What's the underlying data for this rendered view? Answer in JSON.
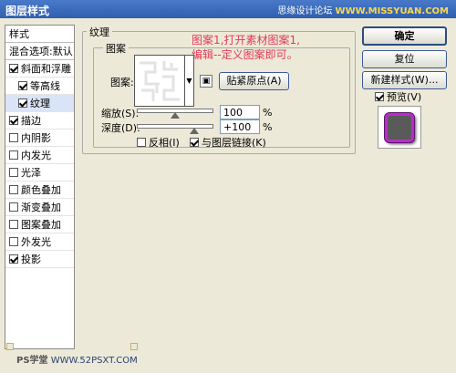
{
  "window": {
    "title": "图层样式"
  },
  "watermark": {
    "site": "思缘设计论坛",
    "brand": "WWW.MISSYUAN.COM",
    "bottom_ps": "PS学堂",
    "bottom_site": "WWW.52PSXT.COM"
  },
  "styles": {
    "header": "样式",
    "blend": "混合选项:默认",
    "items": [
      {
        "label": "斜面和浮雕",
        "checked": true
      },
      {
        "label": "等高线",
        "checked": true,
        "indent": true
      },
      {
        "label": "纹理",
        "checked": true,
        "indent": true,
        "selected": true
      },
      {
        "label": "描边",
        "checked": true
      },
      {
        "label": "内阴影",
        "checked": false
      },
      {
        "label": "内发光",
        "checked": false
      },
      {
        "label": "光泽",
        "checked": false
      },
      {
        "label": "颜色叠加",
        "checked": false
      },
      {
        "label": "渐变叠加",
        "checked": false
      },
      {
        "label": "图案叠加",
        "checked": false
      },
      {
        "label": "外发光",
        "checked": false
      },
      {
        "label": "投影",
        "checked": true
      }
    ]
  },
  "texture": {
    "group_title": "纹理",
    "pattern_group_title": "图案",
    "pattern_label": "图案:",
    "snap_button": "贴紧原点(A)",
    "scale_label": "缩放(S):",
    "scale_value": "100",
    "scale_level": 0.5,
    "depth_label": "深度(D):",
    "depth_value": "+100",
    "depth_level": 0.75,
    "unit": "%",
    "invert_label": "反相(I)",
    "invert_checked": false,
    "link_label": "与图层链接(K)",
    "link_checked": true,
    "annotation_line1": "图案1,打开素材图案1,",
    "annotation_line2": "编辑--定义图案即可。"
  },
  "buttons": {
    "ok": "确定",
    "reset": "复位",
    "new_style": "新建样式(W)..."
  },
  "preview": {
    "label": "预览(V)",
    "checked": true
  },
  "colors": {
    "accent_purple": "#b530c8",
    "annotation_red": "#e23a55"
  }
}
